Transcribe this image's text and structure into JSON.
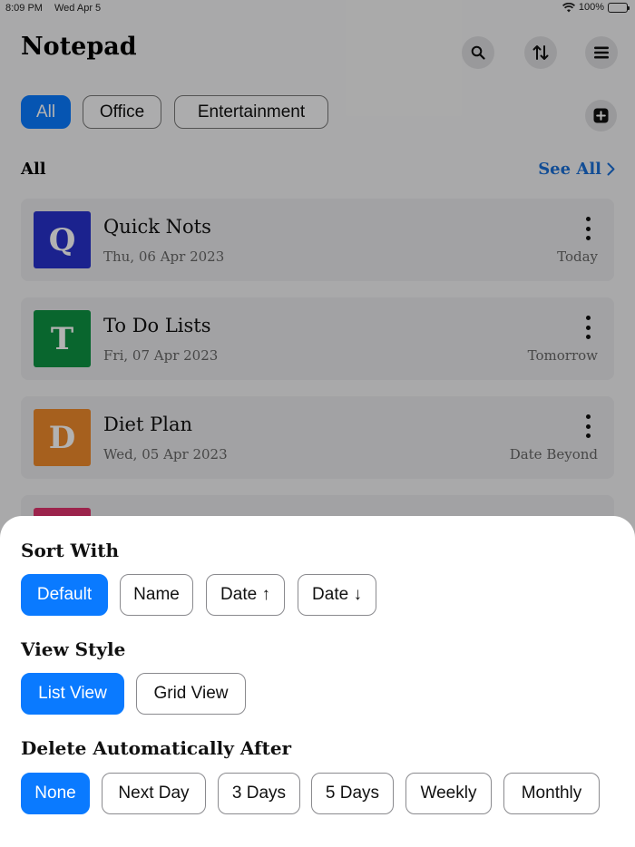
{
  "status_bar": {
    "time": "8:09 PM",
    "date": "Wed Apr 5",
    "battery": "100%"
  },
  "header": {
    "title": "Notepad"
  },
  "categories": [
    "All",
    "Office",
    "Entertainment"
  ],
  "section": {
    "label": "All",
    "see_all": "See All"
  },
  "notes": [
    {
      "initial": "Q",
      "title": "Quick Nots",
      "date": "Thu, 06 Apr 2023",
      "when": "Today",
      "color": "#2732cc"
    },
    {
      "initial": "T",
      "title": "To Do Lists",
      "date": "Fri, 07 Apr 2023",
      "when": "Tomorrow",
      "color": "#0e9242"
    },
    {
      "initial": "D",
      "title": "Diet Plan",
      "date": "Wed, 05 Apr 2023",
      "when": "Date Beyond",
      "color": "#ee8a2c"
    }
  ],
  "sheet": {
    "sort_heading": "Sort With",
    "sort_options": [
      "Default",
      "Name",
      "Date ↑",
      "Date ↓"
    ],
    "view_heading": "View Style",
    "view_options": [
      "List View",
      "Grid View"
    ],
    "delete_heading": "Delete Automatically After",
    "delete_options": [
      "None",
      "Next Day",
      "3 Days",
      "5 Days",
      "Weekly",
      "Monthly"
    ]
  },
  "colors": {
    "accent": "#0a7aff",
    "link": "#1a6fd6"
  }
}
